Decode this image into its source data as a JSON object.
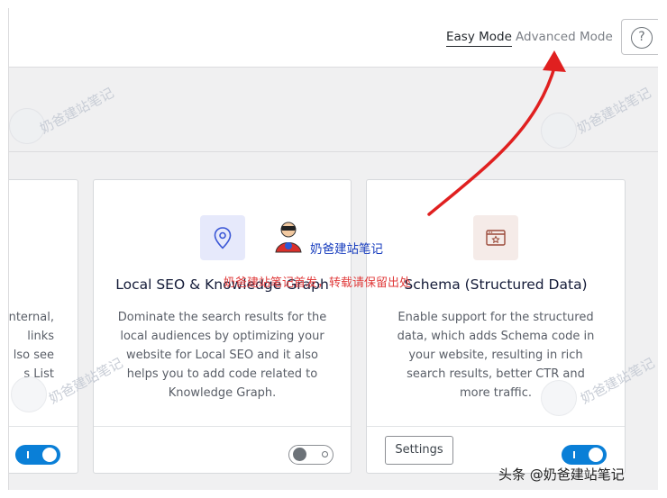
{
  "header": {
    "modes": {
      "easy": "Easy Mode",
      "advanced": "Advanced Mode"
    },
    "help_icon": "help-icon",
    "help_glyph": "?"
  },
  "cards": {
    "partial": {
      "desc_lines": [
        "nternal,",
        "links",
        "lso see",
        "s List"
      ],
      "toggle_on": true
    },
    "local_seo": {
      "icon": "map-pin-icon",
      "title": "Local SEO & Knowledge Graph",
      "description": "Dominate the search results for the local audiences by optimizing your website for Local SEO and it also helps you to add code related to Knowledge Graph.",
      "toggle_on": false
    },
    "schema": {
      "icon": "schema-window-icon",
      "title": "Schema (Structured Data)",
      "description": "Enable support for the structured data, which adds Schema code in your website, resulting in rich search results, better CTR and more traffic.",
      "settings_label": "Settings",
      "toggle_on": true
    }
  },
  "watermarks": {
    "brand": "奶爸建站笔记",
    "copyright": "奶爸建站笔记首发，转载请保留出处",
    "credit": "头条 @奶爸建站笔记"
  },
  "colors": {
    "accent": "#0a7fd7",
    "annotation_arrow": "#e02020",
    "copyright_text": "#e03b3b",
    "brand_text": "#1a3fbf"
  }
}
